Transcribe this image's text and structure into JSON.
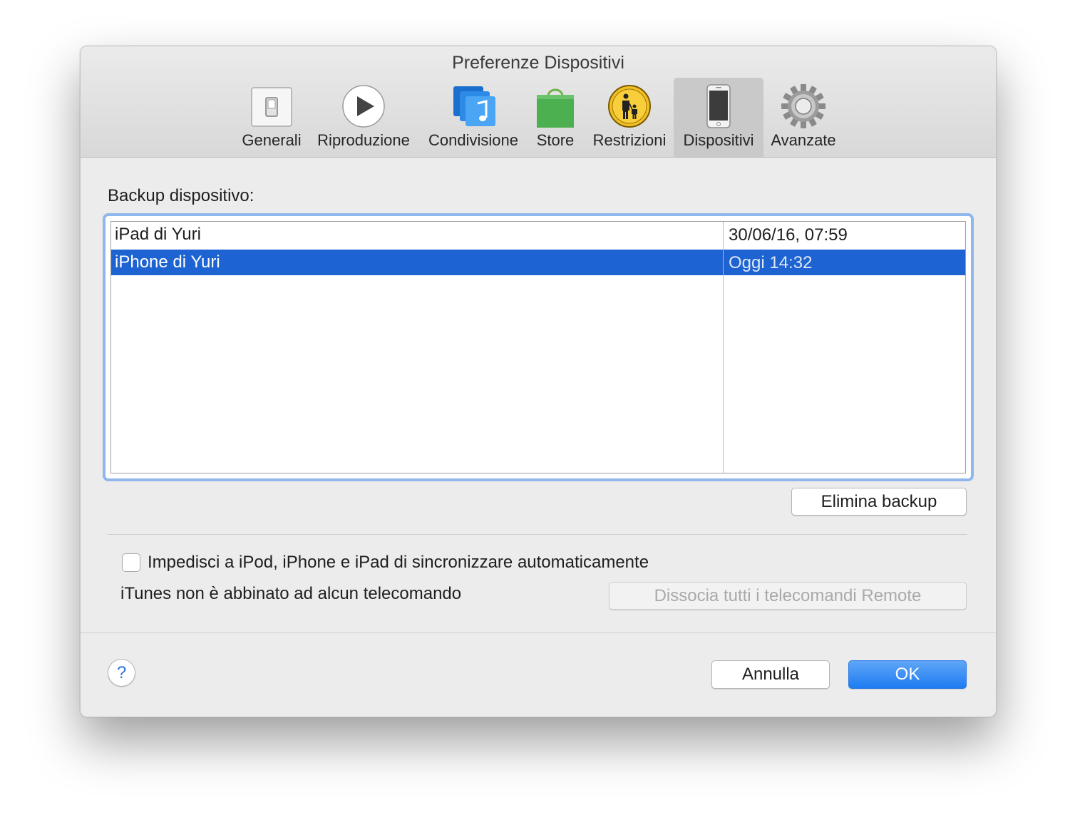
{
  "window": {
    "title": "Preferenze Dispositivi"
  },
  "toolbar": {
    "items": [
      {
        "label": "Generali",
        "icon": "switch-icon"
      },
      {
        "label": "Riproduzione",
        "icon": "play-icon"
      },
      {
        "label": "Condivisione",
        "icon": "music-library-icon"
      },
      {
        "label": "Store",
        "icon": "shopping-bag-icon"
      },
      {
        "label": "Restrizioni",
        "icon": "parental-icon"
      },
      {
        "label": "Dispositivi",
        "icon": "iphone-icon"
      },
      {
        "label": "Avanzate",
        "icon": "gear-icon"
      }
    ],
    "selected": "Dispositivi"
  },
  "backup": {
    "label": "Backup dispositivo:",
    "rows": [
      {
        "name": "iPad di Yuri",
        "date": "30/06/16, 07:59",
        "selected": false
      },
      {
        "name": "iPhone di Yuri",
        "date": "Oggi 14:32",
        "selected": true
      }
    ],
    "delete_button": "Elimina backup"
  },
  "options": {
    "prevent_sync_label": "Impedisci a iPod, iPhone e iPad di sincronizzare automaticamente",
    "prevent_sync_checked": false,
    "remote_status": "iTunes non è abbinato ad alcun telecomando",
    "unpair_button": "Dissocia tutti i telecomandi Remote",
    "unpair_enabled": false
  },
  "footer": {
    "help": "?",
    "cancel": "Annulla",
    "ok": "OK"
  },
  "colors": {
    "selection": "#1e63d2",
    "focus_ring": "#8fb7ec",
    "primary_button": "#1e7cf1"
  }
}
